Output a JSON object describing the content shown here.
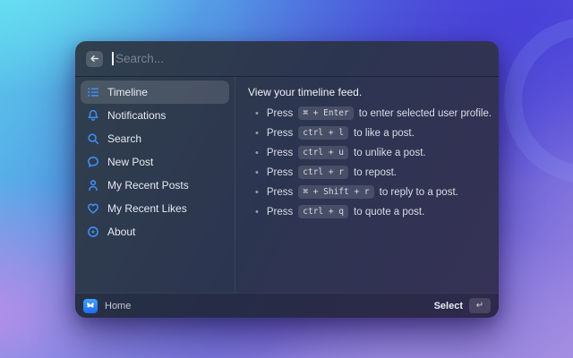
{
  "colors": {
    "accent_blue": "#3f8cf3",
    "app_icon_blue_top": "#42a2ff",
    "app_icon_blue_bottom": "#1e6bf0",
    "selected_item_bg": "rgba(255,255,255,0.13)",
    "window_top": "#30404d",
    "window_bottom": "#363156"
  },
  "window": {
    "search": {
      "placeholder": "Search..."
    },
    "sidebar": {
      "items": [
        {
          "label": "Timeline",
          "icon": "timeline-list-icon",
          "selected": true
        },
        {
          "label": "Notifications",
          "icon": "bell-icon",
          "selected": false
        },
        {
          "label": "Search",
          "icon": "search-icon",
          "selected": false
        },
        {
          "label": "New Post",
          "icon": "speech-bubble-icon",
          "selected": false
        },
        {
          "label": "My Recent Posts",
          "icon": "person-icon",
          "selected": false
        },
        {
          "label": "My Recent Likes",
          "icon": "heart-icon",
          "selected": false
        },
        {
          "label": "About",
          "icon": "info-circle-icon",
          "selected": false
        }
      ]
    },
    "detail": {
      "heading": "View your timeline feed.",
      "press_label": "Press",
      "shortcuts": [
        {
          "keys": "⌘ + Enter",
          "description": "to enter selected user profile."
        },
        {
          "keys": "ctrl + l",
          "description": "to like a post."
        },
        {
          "keys": "ctrl + u",
          "description": "to unlike a post."
        },
        {
          "keys": "ctrl + r",
          "description": "to repost."
        },
        {
          "keys": "⌘ + Shift + r",
          "description": "to reply to a post."
        },
        {
          "keys": "ctrl + q",
          "description": "to quote a post."
        }
      ]
    },
    "footer": {
      "app_label": "Home",
      "select_label": "Select",
      "select_key": "↵"
    }
  }
}
